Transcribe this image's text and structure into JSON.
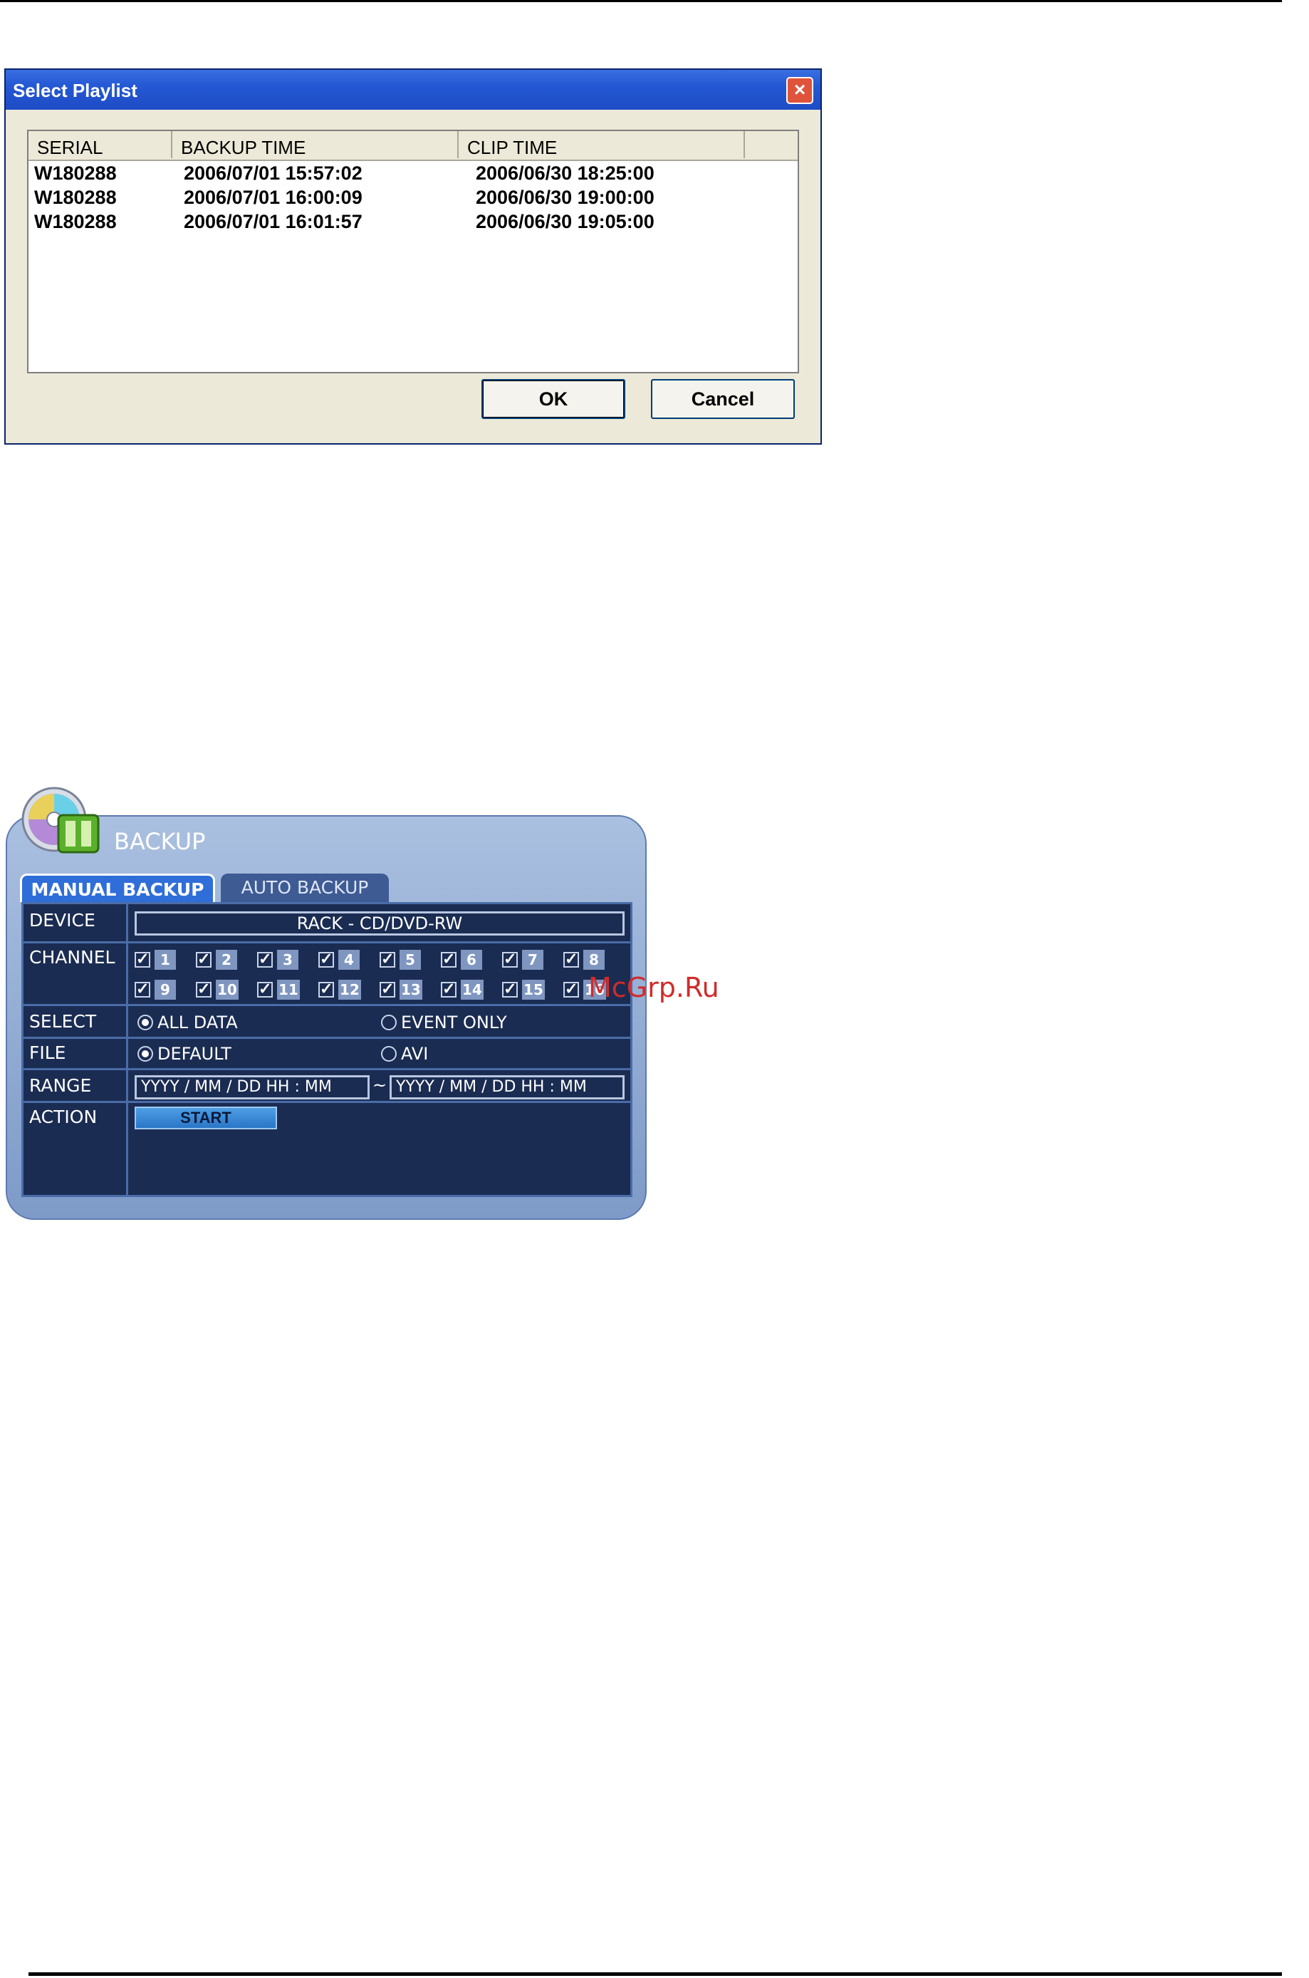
{
  "dialog": {
    "title": "Select Playlist",
    "close_label": "×",
    "columns": [
      "SERIAL",
      "BACKUP TIME",
      "CLIP TIME",
      ""
    ],
    "rows": [
      {
        "serial": "W180288",
        "backup_time": "2006/07/01 15:57:02",
        "clip_time": "2006/06/30 18:25:00"
      },
      {
        "serial": "W180288",
        "backup_time": "2006/07/01 16:00:09",
        "clip_time": "2006/06/30 19:00:00"
      },
      {
        "serial": "W180288",
        "backup_time": "2006/07/01 16:01:57",
        "clip_time": "2006/06/30 19:05:00"
      }
    ],
    "ok_label": "OK",
    "cancel_label": "Cancel"
  },
  "backup": {
    "title": "BACKUP",
    "tabs": [
      "MANUAL BACKUP",
      "AUTO BACKUP"
    ],
    "labels": {
      "device": "DEVICE",
      "channel": "CHANNEL",
      "select": "SELECT",
      "file": "FILE",
      "range": "RANGE",
      "action": "ACTION"
    },
    "device_value": "RACK - CD/DVD-RW",
    "channels": [
      "1",
      "2",
      "3",
      "4",
      "5",
      "6",
      "7",
      "8",
      "9",
      "10",
      "11",
      "12",
      "13",
      "14",
      "15",
      "16"
    ],
    "select_options": {
      "all": "ALL DATA",
      "event": "EVENT ONLY",
      "selected": "ALL DATA"
    },
    "file_options": {
      "default": "DEFAULT",
      "avi": "AVI",
      "selected": "DEFAULT"
    },
    "range_from": "YYYY / MM / DD   HH : MM",
    "range_sep": "~",
    "range_to": "YYYY / MM / DD   HH : MM",
    "start_label": "START"
  },
  "watermark": "McGrp.Ru",
  "colors": {
    "dialog_title": "#2458d4",
    "panel_bg": "#1b2c52",
    "tab_active": "#2f6ed8",
    "start_button": "#2a76c8"
  }
}
